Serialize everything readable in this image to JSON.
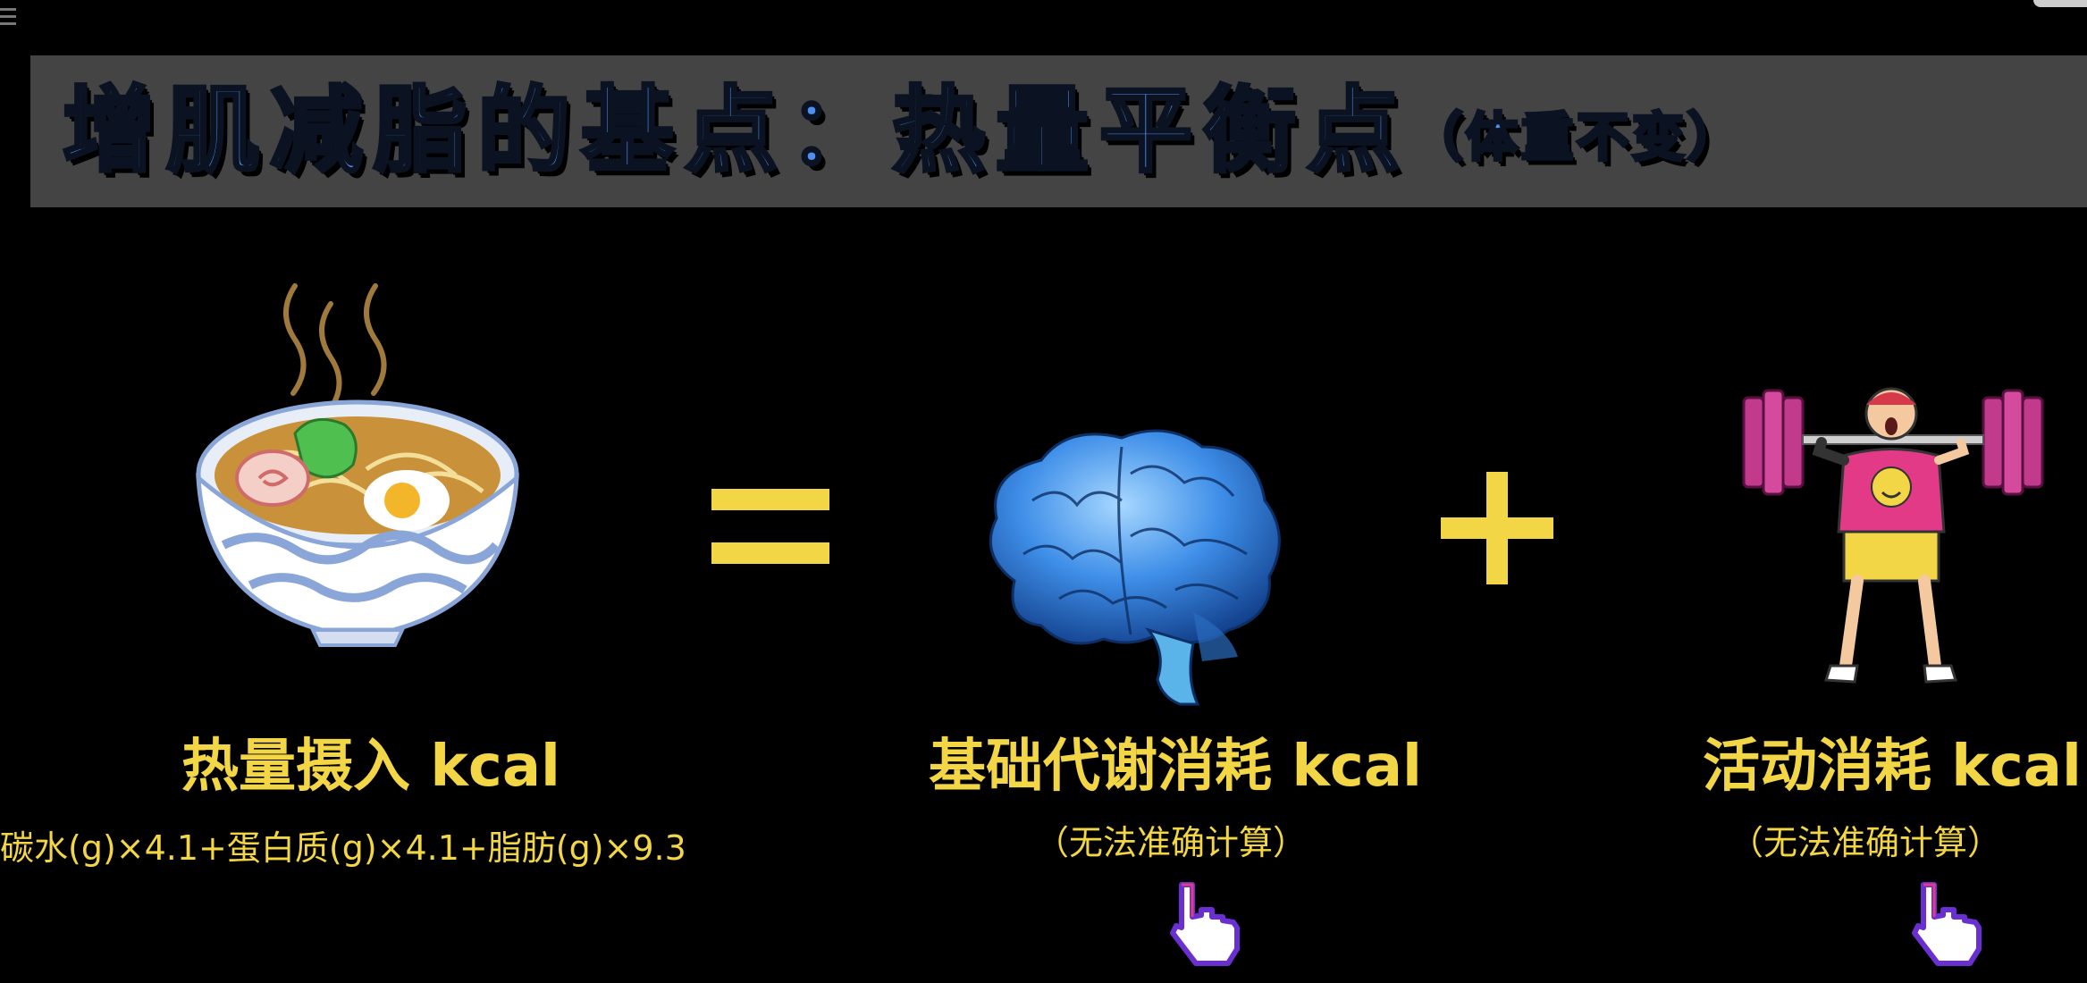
{
  "banner": {
    "title": "增肌减脂的基点：热量平衡点",
    "subtitle": "（体重不变）"
  },
  "intake": {
    "label": "热量摄入 kcal",
    "formula": "碳水(g)×4.1+蛋白质(g)×4.1+脂肪(g)×9.3"
  },
  "bmr": {
    "label": "基础代谢消耗 kcal",
    "note": "（无法准确计算）"
  },
  "activity": {
    "label": "活动消耗 kcal",
    "note": "（无法准确计算）"
  },
  "colors": {
    "banner_text": "#4e8ff0",
    "banner_bg": "#444444",
    "label": "#f2d645",
    "background": "#000000"
  }
}
